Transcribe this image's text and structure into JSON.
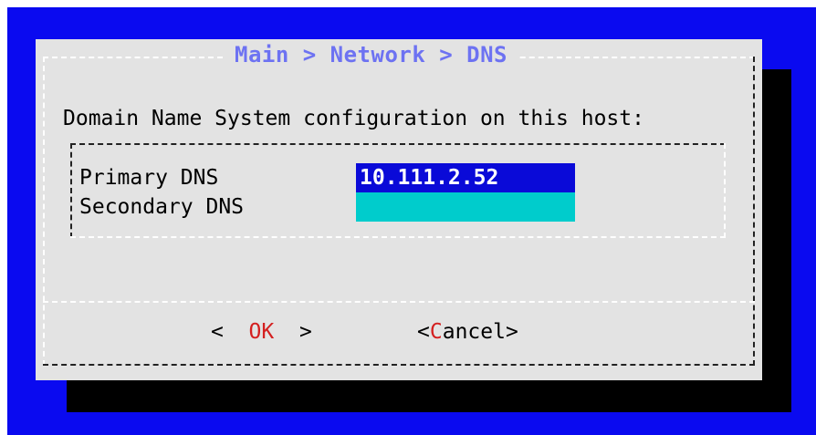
{
  "dialog": {
    "title": "Main > Network > DNS",
    "prompt": "Domain Name System configuration on this host:"
  },
  "form": {
    "primary": {
      "label": "Primary DNS",
      "value": "10.111.2.52"
    },
    "secondary": {
      "label": "Secondary DNS",
      "value": ""
    }
  },
  "buttons": {
    "ok": {
      "open": "<  ",
      "hotkey": "O",
      "rest": "K",
      "close": "  >"
    },
    "cancel": {
      "open": "<",
      "hotkey": "C",
      "rest": "ancel",
      "close": ">"
    }
  },
  "colors": {
    "screen_bg": "#0a0af0",
    "dialog_bg": "#e3e3e3",
    "title": "#6d72f2",
    "active_field": "#0a0ad8",
    "inactive_field": "#00cccc",
    "hotkey": "#d42020"
  }
}
